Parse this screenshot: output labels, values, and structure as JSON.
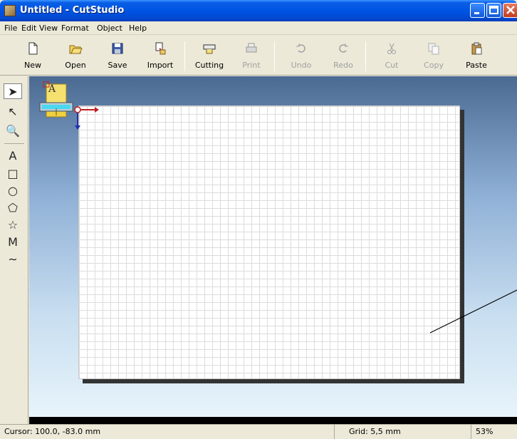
{
  "window": {
    "title": "Untitled - CutStudio"
  },
  "menu": {
    "file": "File",
    "edit": "Edit",
    "view": "View",
    "format": "Format",
    "object": "Object",
    "help": "Help"
  },
  "toolbar": {
    "new": "New",
    "open": "Open",
    "save": "Save",
    "import": "Import",
    "cutting": "Cutting",
    "print": "Print",
    "undo": "Undo",
    "redo": "Redo",
    "cut": "Cut",
    "copy": "Copy",
    "paste": "Paste"
  },
  "tools": {
    "select_glyph": "➤",
    "node_glyph": "↖",
    "zoom_glyph": "🔍",
    "text_glyph": "A",
    "rect_glyph": "□",
    "ellipse_glyph": "○",
    "polygon_glyph": "⬠",
    "star_glyph": "☆",
    "polyline_glyph": "M",
    "curve_glyph": "∼"
  },
  "origin_widget": {
    "letter": "A"
  },
  "status": {
    "cursor": "Cursor: 100.0, -83.0 mm",
    "grid": "Grid: 5,5 mm",
    "zoom": "53%"
  },
  "colors": {
    "title_blue": "#0054E3",
    "canvas_top": "#4a6a92",
    "canvas_bottom": "#e7f4fb",
    "grid_line": "#dcdcdc"
  }
}
